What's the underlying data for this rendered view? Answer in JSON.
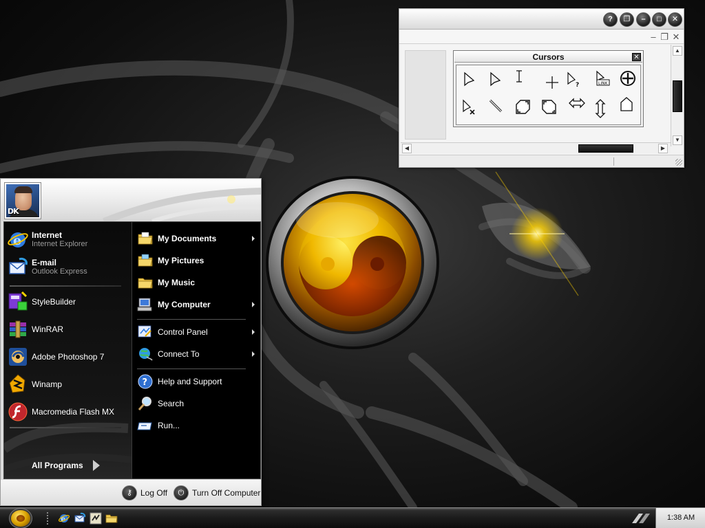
{
  "start_menu": {
    "user_badge": "DK",
    "pinned": [
      {
        "title": "Internet",
        "subtitle": "Internet Explorer",
        "icon": "internet-explorer-icon"
      },
      {
        "title": "E-mail",
        "subtitle": "Outlook Express",
        "icon": "outlook-express-icon"
      }
    ],
    "recent": [
      {
        "title": "StyleBuilder",
        "icon": "stylebuilder-icon"
      },
      {
        "title": "WinRAR",
        "icon": "winrar-icon"
      },
      {
        "title": "Adobe Photoshop 7",
        "icon": "photoshop-icon"
      },
      {
        "title": "Winamp",
        "icon": "winamp-icon"
      },
      {
        "title": "Macromedia Flash MX",
        "icon": "flash-icon"
      }
    ],
    "all_programs": "All Programs",
    "places": [
      {
        "label": "My Documents",
        "icon": "documents-folder-icon",
        "has_submenu": true
      },
      {
        "label": "My Pictures",
        "icon": "pictures-folder-icon",
        "has_submenu": false
      },
      {
        "label": "My Music",
        "icon": "music-folder-icon",
        "has_submenu": false
      },
      {
        "label": "My Computer",
        "icon": "computer-icon",
        "has_submenu": true
      }
    ],
    "system": [
      {
        "label": "Control Panel",
        "icon": "control-panel-icon",
        "has_submenu": true
      },
      {
        "label": "Connect To",
        "icon": "network-globe-icon",
        "has_submenu": true
      }
    ],
    "tools": [
      {
        "label": "Help and Support",
        "icon": "help-icon"
      },
      {
        "label": "Search",
        "icon": "search-icon"
      },
      {
        "label": "Run...",
        "icon": "run-icon"
      }
    ],
    "footer": {
      "log_off": "Log Off",
      "turn_off": "Turn Off Computer"
    }
  },
  "cursors_window": {
    "title_buttons": [
      "?",
      "restore",
      "minimize",
      "maximize",
      "close"
    ],
    "toolbar": {
      "title": "Cursors",
      "items": [
        "arrow-cursor-icon",
        "arrow-cursor-alt-icon",
        "text-beam-cursor-icon",
        "crosshair-cursor-icon",
        "help-select-cursor-icon",
        "link-select-cursor-icon",
        "move-cursor-icon",
        "unavailable-cursor-icon",
        "handwriting-cursor-icon",
        "diagonal-resize-1-cursor-icon",
        "diagonal-resize-2-cursor-icon",
        "horizontal-resize-cursor-icon",
        "vertical-resize-cursor-icon",
        "alternate-select-cursor-icon"
      ]
    }
  },
  "taskbar": {
    "clock": "1:38 AM",
    "quick_launch": [
      "internet-explorer-icon",
      "outlook-express-icon",
      "winamp-icon",
      "folder-icon"
    ]
  },
  "colors": {
    "menu_left_bg": "#0a0a0a",
    "menu_right_bg": "#000000",
    "accent_gold": "#d9a000"
  }
}
